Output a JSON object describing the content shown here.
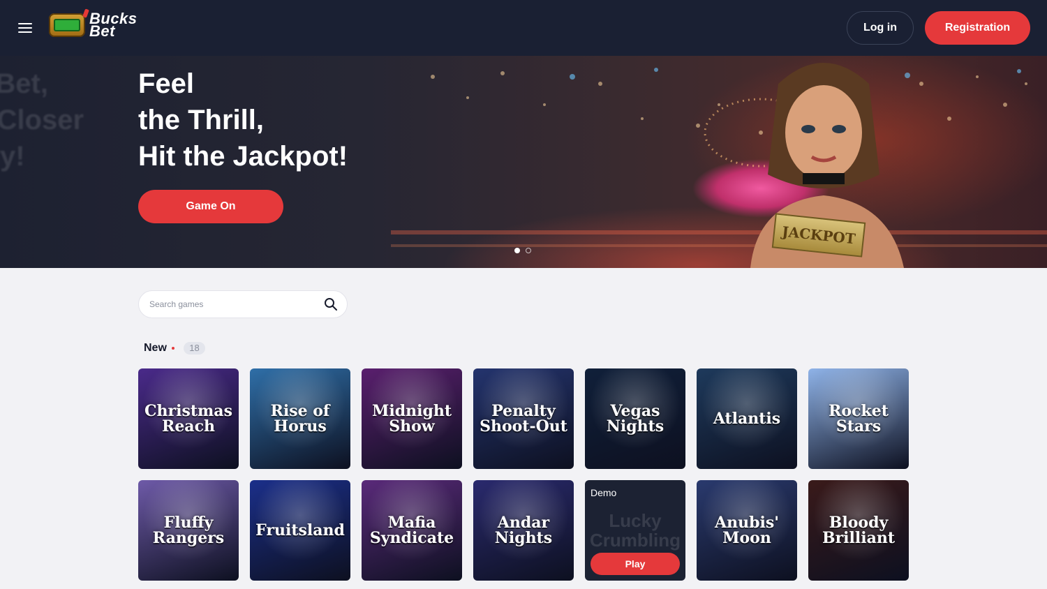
{
  "header": {
    "logo_text_line1": "Bucks",
    "logo_text_line2": "Bet",
    "login_label": "Log in",
    "register_label": "Registration"
  },
  "hero": {
    "ghost_line1": "y Bet,",
    "ghost_line2": "p Closer",
    "ghost_line3": "ory!",
    "title_line1": "Feel",
    "title_line2": "the Thrill,",
    "title_line3": "Hit the Jackpot!",
    "cta_label": "Game On",
    "card_text": "JACKPOT",
    "slides": 2,
    "active_slide": 1
  },
  "search": {
    "placeholder": "Search games"
  },
  "section": {
    "title": "New",
    "count": "18"
  },
  "games": [
    {
      "name": "Christmas Reach",
      "bg": "#4a2a8a"
    },
    {
      "name": "Rise of Horus",
      "bg": "#2f6fa8"
    },
    {
      "name": "Midnight Show",
      "bg": "#5a1f6e"
    },
    {
      "name": "Penalty Shoot-Out",
      "bg": "#24346e"
    },
    {
      "name": "Vegas Nights",
      "bg": "#10203a"
    },
    {
      "name": "Atlantis",
      "bg": "#1e3a5c"
    },
    {
      "name": "Rocket Stars",
      "bg": "#8fb3e8"
    },
    {
      "name": "Fluffy Rangers",
      "bg": "#6e5aa8"
    },
    {
      "name": "Fruitsland",
      "bg": "#1b2f8a"
    },
    {
      "name": "Mafia Syndicate",
      "bg": "#5a2a7a"
    },
    {
      "name": "Andar Nights",
      "bg": "#2a2a6e"
    },
    {
      "name": "Lucky Crumbling",
      "bg": "#1c2233",
      "demo": true,
      "demo_label": "Demo",
      "play_label": "Play"
    },
    {
      "name": "Anubis' Moon",
      "bg": "#2a3a6e"
    },
    {
      "name": "Bloody Brilliant",
      "bg": "#3a1a1a"
    }
  ]
}
